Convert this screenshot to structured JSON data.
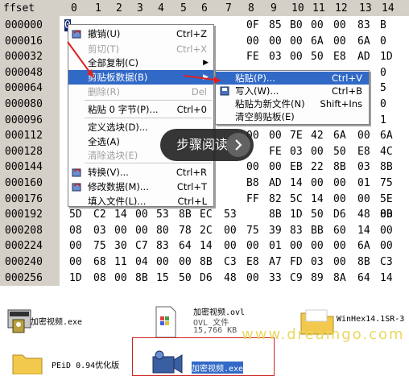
{
  "hex_editor": {
    "header_offset_label": "ffset",
    "column_headers": [
      "0",
      "1",
      "2",
      "3",
      "4",
      "5",
      "6",
      "7",
      "8",
      "9",
      "10",
      "11",
      "12",
      "13",
      "14"
    ],
    "rows": [
      {
        "offset": "000000",
        "cells": [
          "",
          "",
          "",
          "",
          "",
          "",
          "",
          "",
          "0F",
          "85",
          "B0",
          "00",
          "00",
          "83",
          "B"
        ]
      },
      {
        "offset": "000016",
        "cells": [
          "",
          "",
          "",
          "",
          "",
          "",
          "A3",
          "",
          "00",
          "00",
          "00",
          "6A",
          "00",
          "6A",
          "0"
        ]
      },
      {
        "offset": "000032",
        "cells": [
          "",
          "",
          "",
          "",
          "",
          "",
          "79",
          "",
          "FE",
          "03",
          "00",
          "50",
          "E8",
          "AD",
          "1D"
        ]
      },
      {
        "offset": "000048",
        "cells": [
          "",
          "",
          "",
          "",
          "",
          "",
          "",
          "",
          "",
          "",
          "",
          "",
          "",
          "",
          "0"
        ]
      },
      {
        "offset": "000064",
        "cells": [
          "",
          "",
          "",
          "",
          "",
          "",
          "",
          "",
          "",
          "",
          "",
          "",
          "",
          "",
          "5"
        ]
      },
      {
        "offset": "000080",
        "cells": [
          "",
          "",
          "",
          "",
          "",
          "",
          "",
          "",
          "",
          "",
          "",
          "",
          "",
          "",
          "0"
        ]
      },
      {
        "offset": "000096",
        "cells": [
          "",
          "",
          "",
          "",
          "",
          "",
          "",
          "",
          "",
          "",
          "",
          "",
          "",
          "",
          "1"
        ]
      },
      {
        "offset": "000112",
        "cells": [
          "",
          "",
          "",
          "",
          "",
          "",
          "",
          "",
          "00",
          "00",
          "7E",
          "42",
          "6A",
          "00",
          "6A"
        ]
      },
      {
        "offset": "000128",
        "cells": [
          "",
          "",
          "",
          "",
          "",
          "",
          "",
          "",
          "",
          "FE",
          "03",
          "00",
          "50",
          "E8",
          "4C"
        ]
      },
      {
        "offset": "000144",
        "cells": [
          "",
          "",
          "",
          "",
          "",
          "",
          "14",
          "",
          "00",
          "00",
          "EB",
          "22",
          "8B",
          "03",
          "8B"
        ]
      },
      {
        "offset": "000160",
        "cells": [
          "",
          "",
          "",
          "",
          "",
          "",
          "30",
          "",
          "B8",
          "AD",
          "14",
          "00",
          "00",
          "01",
          "75"
        ]
      },
      {
        "offset": "000176",
        "cells": [
          "",
          "",
          "",
          "",
          "",
          "",
          "13",
          "",
          "FF",
          "82",
          "5C",
          "14",
          "00",
          "00",
          "5E"
        ]
      },
      {
        "offset": "000192",
        "cells": [
          "5D",
          "C2",
          "14",
          "00",
          "53",
          "8B",
          "EC",
          "53",
          "",
          "8B",
          "1D",
          "50",
          "D6",
          "48",
          "00",
          "8B"
        ]
      },
      {
        "offset": "000208",
        "cells": [
          "08",
          "03",
          "00",
          "00",
          "80",
          "78",
          "2C",
          "00",
          "75",
          "39",
          "83",
          "BB",
          "60",
          "14",
          "00"
        ]
      },
      {
        "offset": "000224",
        "cells": [
          "00",
          "75",
          "30",
          "C7",
          "83",
          "64",
          "14",
          "00",
          "00",
          "01",
          "00",
          "00",
          "00",
          "6A",
          "00"
        ]
      },
      {
        "offset": "000240",
        "cells": [
          "00",
          "68",
          "11",
          "04",
          "00",
          "00",
          "8B",
          "C3",
          "E8",
          "A7",
          "FD",
          "03",
          "00",
          "8B",
          "C3"
        ]
      },
      {
        "offset": "000256",
        "cells": [
          "1D",
          "08",
          "00",
          "8B",
          "15",
          "50",
          "D6",
          "48",
          "00",
          "33",
          "C9",
          "89",
          "8A",
          "64",
          "14"
        ]
      }
    ],
    "selected_cell": "0"
  },
  "context_menu": {
    "items": [
      {
        "label": "撤销(U)",
        "shortcut": "Ctrl+Z",
        "disabled": false,
        "icon": "undo-icon"
      },
      {
        "label": "剪切(T)",
        "shortcut": "Ctrl+X",
        "disabled": true,
        "icon": ""
      },
      {
        "label": "全部复制(C)",
        "shortcut": "",
        "disabled": false,
        "icon": "",
        "submenu": true
      },
      {
        "label": "剪贴板数据(B)",
        "shortcut": "",
        "disabled": false,
        "icon": "",
        "submenu": true,
        "highlighted": true
      },
      {
        "label": "删除(R)",
        "shortcut": "Del",
        "disabled": true,
        "icon": ""
      },
      {
        "label": "粘贴 0 字节(P)...",
        "shortcut": "Ctrl+0",
        "disabled": false,
        "icon": ""
      },
      {
        "label": "定义选块(D)...",
        "shortcut": "",
        "disabled": false,
        "icon": ""
      },
      {
        "label": "全选(A)",
        "shortcut": "Ctrl+A",
        "disabled": false,
        "icon": ""
      },
      {
        "label": "清除选块(E)",
        "shortcut": "",
        "disabled": true,
        "icon": ""
      },
      {
        "label": "转换(V)...",
        "shortcut": "Ctrl+R",
        "disabled": false,
        "icon": "convert-icon"
      },
      {
        "label": "修改数据(M)...",
        "shortcut": "Ctrl+T",
        "disabled": false,
        "icon": "modify-data-icon"
      },
      {
        "label": "填入文件(L)...",
        "shortcut": "Ctrl+L",
        "disabled": false,
        "icon": ""
      }
    ]
  },
  "submenu": {
    "items": [
      {
        "label": "粘贴(P)...",
        "shortcut": "Ctrl+V",
        "highlighted": true
      },
      {
        "label": "写入(W)...",
        "shortcut": "Ctrl+B",
        "icon": "write-icon"
      },
      {
        "label": "粘贴为新文件(N)",
        "shortcut": "Shift+Ins"
      },
      {
        "label": "清空剪贴板(E)",
        "shortcut": ""
      }
    ]
  },
  "tooltip": {
    "text": "步骤阅读"
  },
  "desktop": {
    "files": [
      {
        "name": "加密视频.exe",
        "icon": "key-program-icon"
      },
      {
        "name": "加密视频.ovl",
        "type": "OVL 文件",
        "size": "15,766 KB",
        "icon": "document-icon"
      },
      {
        "name": "WinHex14.1SR-3",
        "icon": "folder-icon"
      },
      {
        "name": "PEiD 0.94优化版",
        "icon": "folder-icon"
      },
      {
        "name": "加密视频.exe",
        "icon": "video-camera-icon",
        "selected": true
      }
    ],
    "watermark": "www.dreamgo.com"
  },
  "colors": {
    "selection": "#0a246a",
    "menu_highlight": "#3169c6",
    "header_bg": "#d4d0c8"
  }
}
